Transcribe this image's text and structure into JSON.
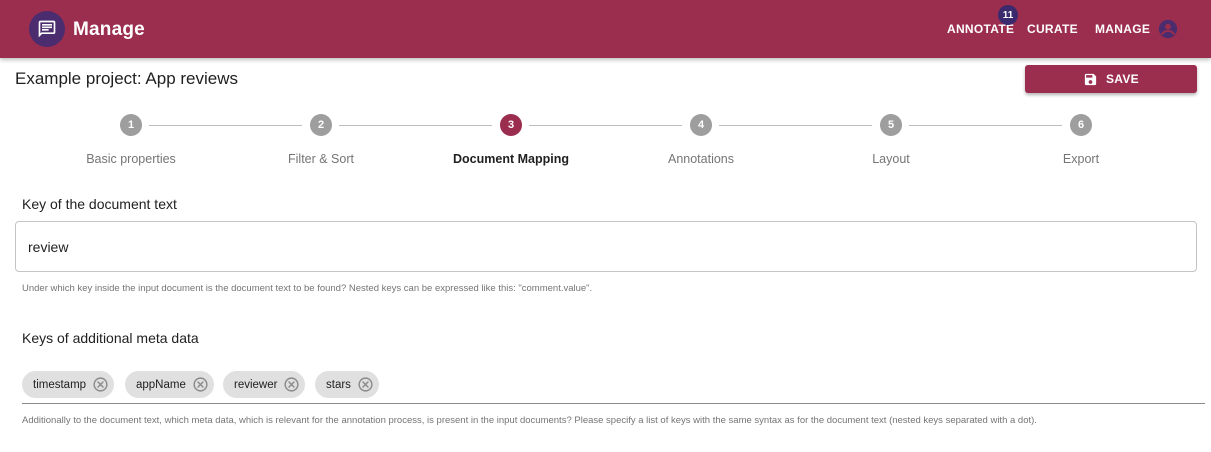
{
  "appbar": {
    "title": "Manage",
    "logo_icon": "message-icon",
    "nav": {
      "annotate": "ANNOTATE",
      "annotate_badge": "11",
      "curate": "CURATE",
      "manage": "MANAGE"
    },
    "account_icon": "account-circle-icon",
    "color": "#9b2d4f",
    "logo_color": "#4b2c6e",
    "badge_color": "#3b2a6e"
  },
  "project": {
    "title": "Example project: App reviews",
    "save_label": "SAVE"
  },
  "stepper": {
    "active_step": 3,
    "steps": [
      {
        "number": "1",
        "label": "Basic properties"
      },
      {
        "number": "2",
        "label": "Filter & Sort"
      },
      {
        "number": "3",
        "label": "Document Mapping"
      },
      {
        "number": "4",
        "label": "Annotations"
      },
      {
        "number": "5",
        "label": "Layout"
      },
      {
        "number": "6",
        "label": "Export"
      }
    ]
  },
  "document_text": {
    "label": "Key of the document text",
    "value": "review",
    "helper": "Under which key inside the input document is the document text to be found? Nested keys can be expressed like this: \"comment.value\"."
  },
  "meta_data": {
    "label": "Keys of additional meta data",
    "chips": [
      "timestamp",
      "appName",
      "reviewer",
      "stars"
    ],
    "helper": "Additionally to the document text, which meta data, which is relevant for the annotation process, is present in the input documents? Please specify a list of keys with the same syntax as for the document text (nested keys separated with a dot)."
  }
}
